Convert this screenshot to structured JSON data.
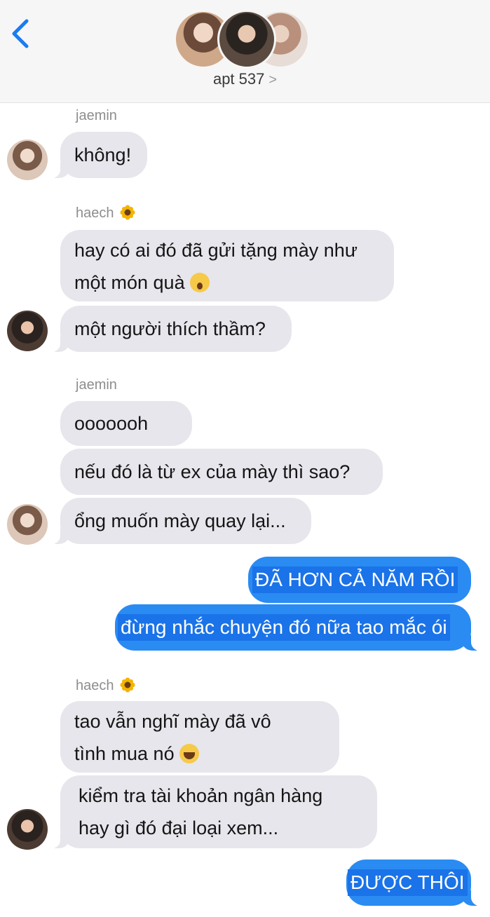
{
  "header": {
    "group_name": "apt 537",
    "chevron": ">",
    "back_icon": "chevron-left-icon",
    "accent_color": "#1a7cf0"
  },
  "messages": {
    "m1": {
      "sender": "jaemin",
      "text": "không!"
    },
    "m2": {
      "sender": "haech",
      "line1": "hay có ai đó đã gửi tặng mày như",
      "line2": "một món quà",
      "emoji": "surprised-face"
    },
    "m3": {
      "text": "một người thích thầm?"
    },
    "m4": {
      "sender": "jaemin",
      "text": "ooooooh"
    },
    "m5": {
      "text": "nếu đó là từ ex của mày thì sao?"
    },
    "m6": {
      "text": "ổng muốn mày quay lại..."
    },
    "m7": {
      "text": "ĐÃ HƠN CẢ NĂM RỒI"
    },
    "m8": {
      "text": "đừng nhắc chuyện đó nữa tao mắc ói"
    },
    "m9": {
      "sender": "haech",
      "line1": "tao vẫn nghĩ mày đã vô",
      "line2": "tình mua nó",
      "emoji": "crying-face"
    },
    "m10": {
      "line1": "kiểm tra tài khoản ngân hàng",
      "line2": "hay gì đó đại loại xem..."
    },
    "m11": {
      "text": "ĐƯỢC THÔI"
    }
  },
  "colors": {
    "incoming_bubble": "#e6e6ec",
    "outgoing_bubble": "#2a8bf2",
    "text_highlight": "#1a73e8"
  }
}
